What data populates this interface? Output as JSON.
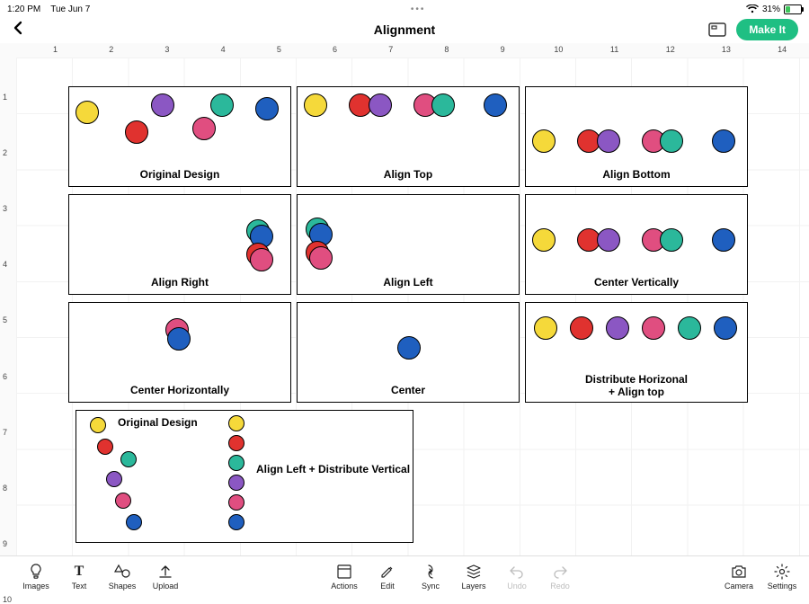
{
  "status": {
    "time": "1:20 PM",
    "date": "Tue Jun 7",
    "battery_pct": "31%",
    "battery_fill": 31
  },
  "header": {
    "title": "Alignment",
    "make_it": "Make It"
  },
  "ruler": {
    "h": [
      "1",
      "2",
      "3",
      "4",
      "5",
      "6",
      "7",
      "8",
      "9",
      "10",
      "11",
      "12",
      "13",
      "14"
    ],
    "v": [
      "1",
      "2",
      "3",
      "4",
      "5",
      "6",
      "7",
      "8",
      "9",
      "10"
    ]
  },
  "colors": {
    "yellow": "#f5d93a",
    "red": "#e0322f",
    "purple": "#8b57c3",
    "pink": "#e04e80",
    "teal": "#2bb89b",
    "blue": "#1f5fbf"
  },
  "panels": {
    "original": "Original Design",
    "align_top": "Align Top",
    "align_bottom": "Align Bottom",
    "align_right": "Align Right",
    "align_left": "Align Left",
    "center_vertically": "Center Vertically",
    "center_horizontally": "Center Horizontally",
    "center": "Center",
    "distribute": "Distribute Horizonal",
    "distribute2": "+ Align top",
    "ex2_original": "Original Design",
    "ex2_result": "Align Left + Distribute Vertical"
  },
  "toolbar": {
    "images": "Images",
    "text": "Text",
    "shapes": "Shapes",
    "upload": "Upload",
    "actions": "Actions",
    "edit": "Edit",
    "sync": "Sync",
    "layers": "Layers",
    "undo": "Undo",
    "redo": "Redo",
    "camera": "Camera",
    "settings": "Settings"
  }
}
